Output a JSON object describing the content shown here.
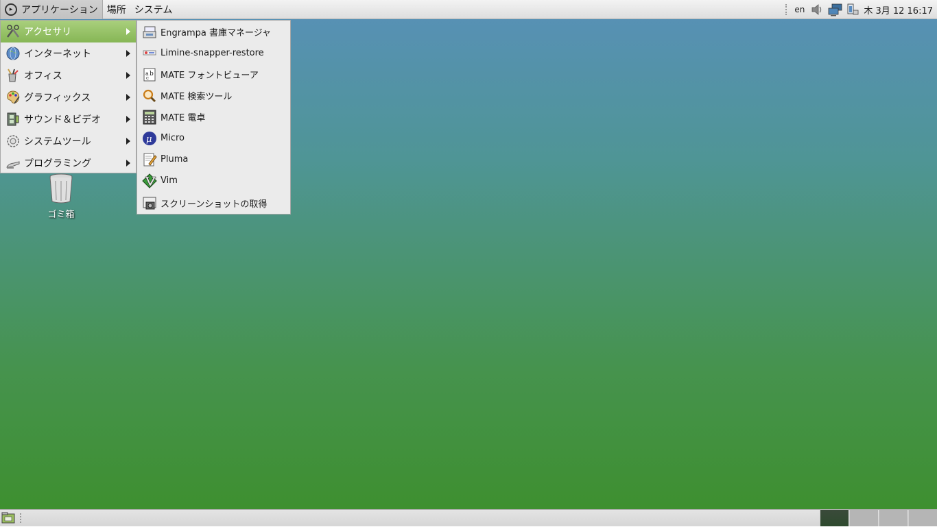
{
  "top_panel": {
    "menus": [
      "アプリケーション",
      "場所",
      "システム"
    ],
    "keyboard_layout": "en",
    "clock": "木 3月 12 16:17"
  },
  "applications_menu": {
    "items": [
      {
        "label": "アクセサリ",
        "icon": "accessories-icon"
      },
      {
        "label": "インターネット",
        "icon": "globe-icon"
      },
      {
        "label": "オフィス",
        "icon": "office-icon"
      },
      {
        "label": "グラフィックス",
        "icon": "graphics-palette-icon"
      },
      {
        "label": "サウンド＆ビデオ",
        "icon": "film-icon"
      },
      {
        "label": "システムツール",
        "icon": "system-gear-icon"
      },
      {
        "label": "プログラミング",
        "icon": "programming-icon"
      }
    ],
    "selected": "アクセサリ"
  },
  "accessories_submenu": {
    "items": [
      {
        "label": "Engrampa 書庫マネージャ",
        "icon": "archive-manager-icon"
      },
      {
        "label": "Limine-snapper-restore",
        "icon": "restore-icon"
      },
      {
        "label": "MATE フォントビューア",
        "icon": "font-viewer-icon"
      },
      {
        "label": "MATE 検索ツール",
        "icon": "search-icon"
      },
      {
        "label": "MATE 電卓",
        "icon": "calculator-icon"
      },
      {
        "label": "Micro",
        "icon": "micro-editor-icon"
      },
      {
        "label": "Pluma",
        "icon": "text-editor-icon"
      },
      {
        "label": "Vim",
        "icon": "vim-icon"
      },
      {
        "label": "スクリーンショットの取得",
        "icon": "screenshot-icon"
      }
    ]
  },
  "desktop": {
    "trash_label": "ゴミ箱"
  },
  "bottom_panel": {
    "workspaces": 4,
    "active_workspace": 1
  },
  "colors": {
    "menu_selected": "#86b655",
    "desktop_top": "#5890b8",
    "desktop_bottom": "#3d8f2c"
  }
}
